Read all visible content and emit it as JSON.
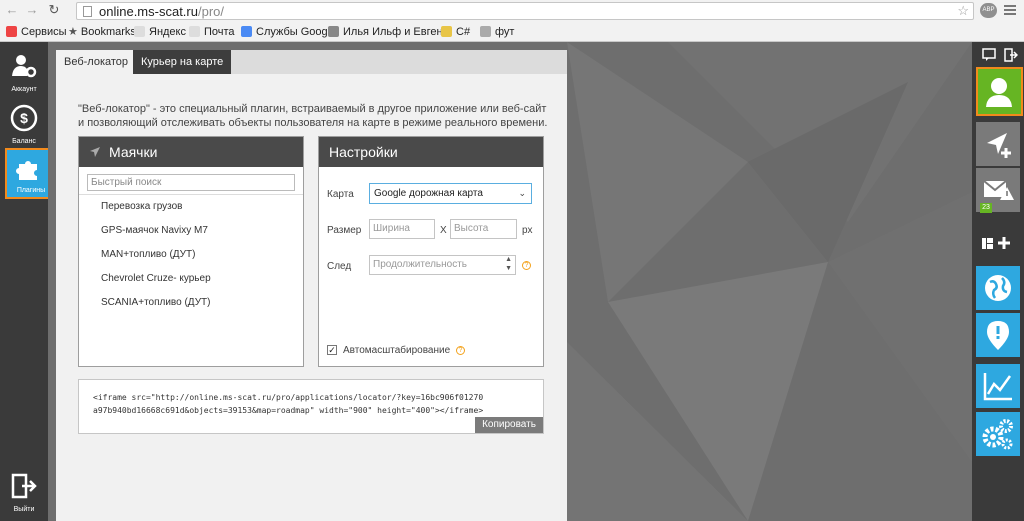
{
  "browser": {
    "url_host": "online.ms-scat.ru",
    "url_path": "/pro/",
    "ext_badge": "АВР",
    "bookmarks": [
      {
        "label": "Сервисы",
        "color": "#e44"
      },
      {
        "label": "Bookmarks",
        "color": "#666"
      },
      {
        "label": "Яндекс",
        "color": "#bbb"
      },
      {
        "label": "Почта",
        "color": "#bbb"
      },
      {
        "label": "Службы Google",
        "color": "#4a8af4"
      },
      {
        "label": "Илья Ильф и Евген...",
        "color": "#777"
      },
      {
        "label": "C#",
        "color": "#e8c547"
      },
      {
        "label": "фут",
        "color": "#999"
      }
    ]
  },
  "left_nav": {
    "account": "Аккаунт",
    "balance": "Баланс",
    "plugins": "Плагины",
    "logout": "Выйти"
  },
  "tabs": {
    "weblocator": "Веб-локатор",
    "courier": "Курьер на карте"
  },
  "description": "\"Веб-локатор\" - это специальный плагин, встраиваемый в другое приложение или веб-сайт и позволяющий отслеживать объекты пользователя на карте в режиме реального времени.",
  "beacons": {
    "title": "Маячки",
    "search_placeholder": "Быстрый поиск",
    "items": [
      "Перевозка грузов",
      "GPS-маячок Navixy M7",
      "MAN+топливо (ДУТ)",
      "Chevrolet Cruze- курьер",
      "SCANIA+топливо (ДУТ)"
    ]
  },
  "settings": {
    "title": "Настройки",
    "map_label": "Карта",
    "map_value": "Google дорожная карта",
    "size_label": "Размер",
    "width_placeholder": "Ширина",
    "x_sep": "X",
    "height_placeholder": "Высота",
    "px_unit": "px",
    "trail_label": "След",
    "duration_placeholder": "Продолжительность",
    "auto_scale_label": "Автомасштабирование",
    "auto_scale_checked": true
  },
  "embed": {
    "line1": "<iframe src=\"http://online.ms-scat.ru/pro/applications/locator/?key=16bc906f01270",
    "line2": "a97b940bd16668c691d&objects=39153&map=roadmap\" width=\"900\" height=\"400\"></iframe>",
    "copy_label": "Копировать"
  },
  "right_bar": {
    "messages_badge": "23"
  },
  "colors": {
    "accent_blue": "#2ea8e0",
    "accent_green": "#66b523",
    "highlight_orange": "#f28a1c",
    "dark_bg": "#3a3a3a"
  }
}
